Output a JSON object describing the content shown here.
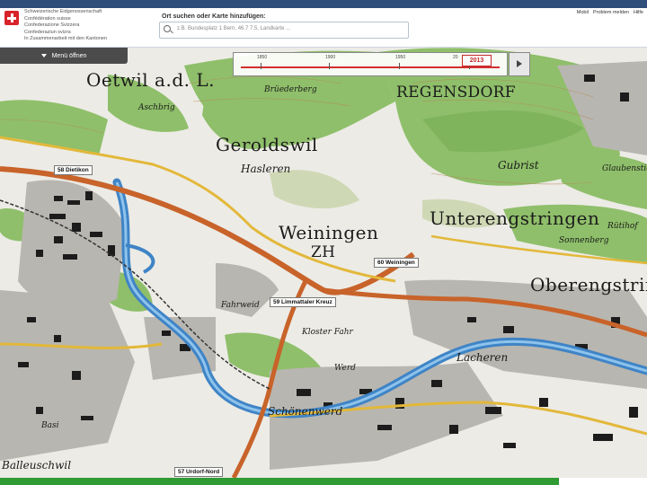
{
  "header": {
    "confederation_lines": [
      "Schweizerische Eidgenossenschaft",
      "Confédération suisse",
      "Confederazione Svizzera",
      "Confederaziun svizra",
      "In Zusammenarbeit mit den Kantonen"
    ],
    "search_label": "Ort suchen oder Karte hinzufügen:",
    "search_placeholder": "z.B. Bundesplatz 1 Bern, 46.7 7.5, Landkarte ...",
    "links": [
      "Mobil",
      "Problem melden",
      "Hilfe"
    ]
  },
  "menu": {
    "label": "Menü öffnen"
  },
  "timeline": {
    "years": [
      "1850",
      "1900",
      "1950",
      "20"
    ],
    "selected_year": "2013"
  },
  "map": {
    "places": {
      "oetwil": "Oetwil a.d. L.",
      "regensdorf": "REGENSDORF",
      "geroldswil": "Geroldswil",
      "hasleren": "Hasleren",
      "weiningen": "Weiningen",
      "zh": "ZH",
      "unterengstringen": "Unterengstringen",
      "oberengstringen": "Oberengstringen",
      "gubrist": "Gubrist",
      "lacheren": "Lacheren",
      "schoenenwerd": "Schönenwerd",
      "ballenschwil": "Balleuschwil",
      "fahrweid": "Fahrweid",
      "kloster_fahr": "Kloster Fahr",
      "ruettihof": "Rütihof",
      "aschbrig": "Aschbrig",
      "brueederberg": "Brüederberg",
      "sonnenberg": "Sonnenberg",
      "werd": "Werd",
      "basi": "Basi",
      "ghangel": "Glaubenstich"
    },
    "road_signs": {
      "dietikon": "58 Dietikon",
      "weiningen_exit": "60 Weiningen",
      "limmattaler_kreuz": "59 Limmattaler Kreuz",
      "urdorf_nord": "57 Urdorf-Nord"
    },
    "colors": {
      "forest": "#8fbf6a",
      "water": "#3f84c6",
      "motorway": "#c8632a",
      "main_road": "#e3b83a",
      "urban": "#6f6f6f"
    }
  }
}
